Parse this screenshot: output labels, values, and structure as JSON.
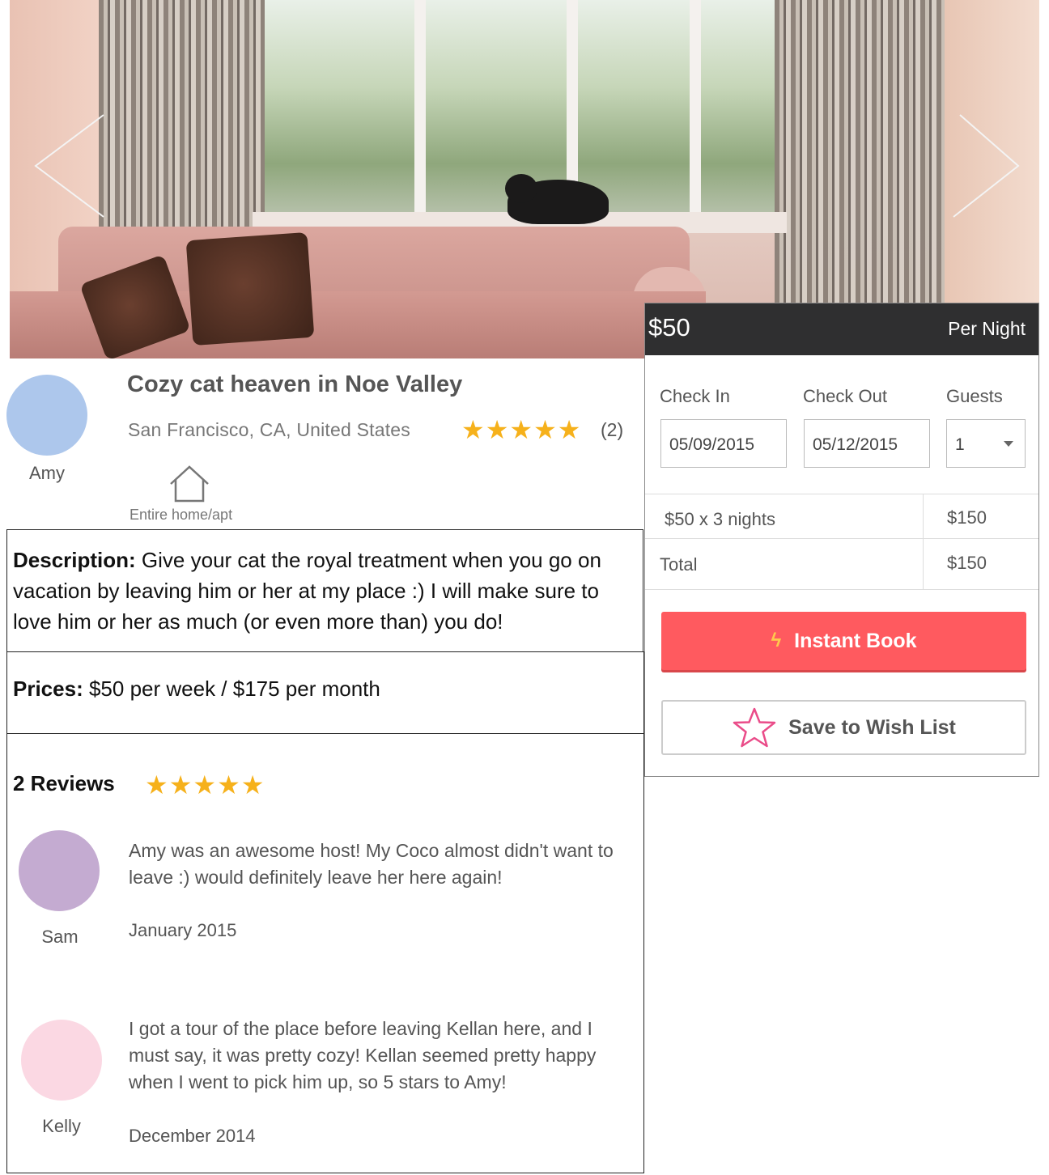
{
  "hero": {
    "prev_icon": "chevron-left-icon",
    "next_icon": "chevron-right-icon"
  },
  "host": {
    "name": "Amy",
    "avatar_color": "#adc7ec"
  },
  "listing": {
    "title": "Cozy cat heaven in Noe Valley",
    "location": "San Francisco, CA, United States",
    "rating_stars": "★★★★★",
    "rating_value": 5,
    "review_count": "(2)",
    "room_type_icon": "home-icon",
    "room_type": "Entire home/apt"
  },
  "description": {
    "label": "Description:",
    "text": "Give your cat the royal treatment when you go on vacation by leaving him or her at my place :) I will make sure to love him or her as much (or even more than) you do!"
  },
  "prices": {
    "label": "Prices:",
    "text": "$50 per week / $175 per month"
  },
  "reviews": {
    "heading": "2 Reviews",
    "stars": "★★★★★",
    "items": [
      {
        "name": "Sam",
        "avatar_color": "#c4abd1",
        "text": "Amy was an awesome host! My Coco almost didn't want to leave :) would definitely leave her here again!",
        "date": "January 2015"
      },
      {
        "name": "Kelly",
        "avatar_color": "#fbd8e3",
        "text": "I got a tour of the place before leaving Kellan here, and I must say, it was pretty cozy! Kellan seemed pretty happy when I went to pick him up, so 5 stars to Amy!",
        "date": "December 2014"
      }
    ]
  },
  "booking": {
    "price": "$50",
    "per": "Per Night",
    "check_in_label": "Check In",
    "check_out_label": "Check Out",
    "guests_label": "Guests",
    "check_in_value": "05/09/2015",
    "check_out_value": "05/12/2015",
    "guests_value": "1",
    "nightly_line": "$50  x 3 nights",
    "nightly_total": "$150",
    "total_label": "Total",
    "total_value": "$150",
    "instant_book_icon": "lightning-bolt-icon",
    "instant_book_label": "Instant Book",
    "wishlist_icon": "star-outline-icon",
    "wishlist_label": "Save to Wish List",
    "accent_color": "#ff5a5f",
    "header_color": "#2f2f30"
  }
}
